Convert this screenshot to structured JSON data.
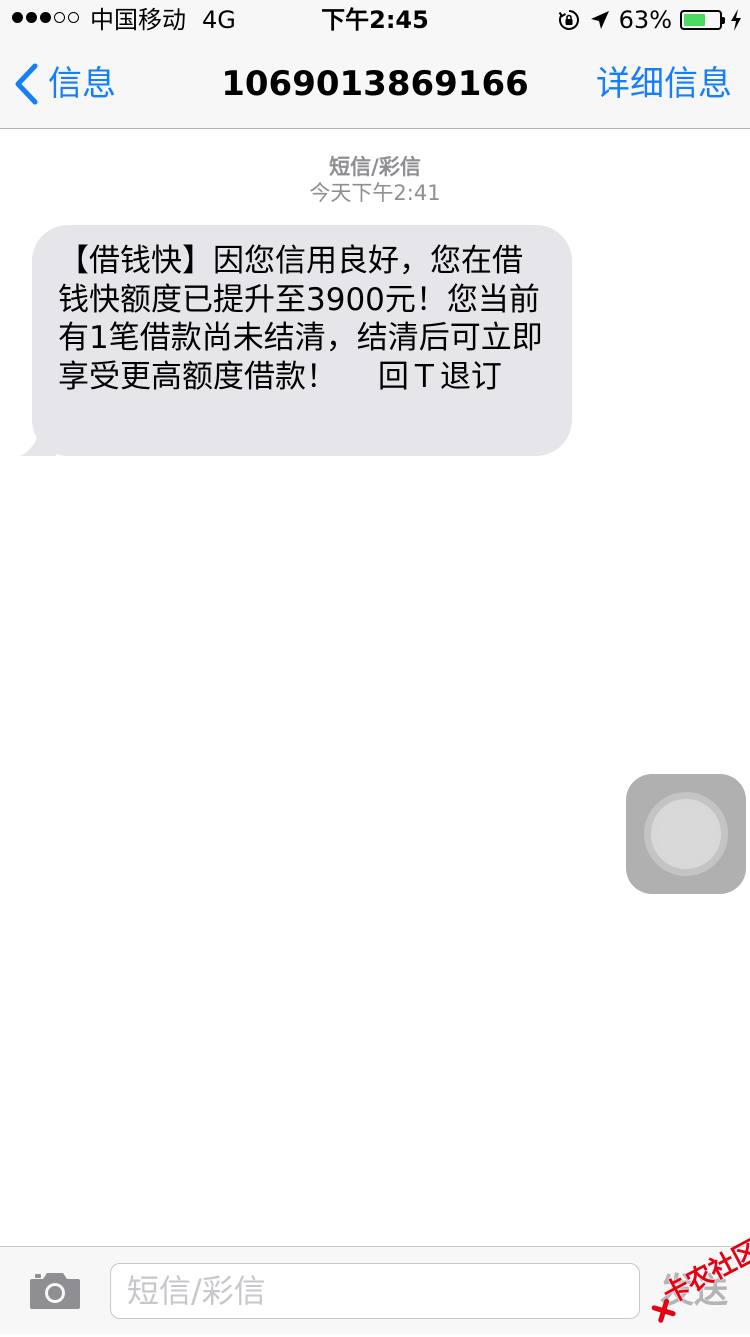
{
  "status_bar": {
    "carrier": "中国移动",
    "network": "4G",
    "time": "下午2:45",
    "battery_percent": "63%",
    "battery_level": 0.63,
    "signal_bars_filled": 3,
    "signal_bars_total": 5,
    "icons": [
      "rotation-lock-icon",
      "location-arrow-icon",
      "battery-icon",
      "charging-bolt-icon"
    ]
  },
  "nav": {
    "back_label": "信息",
    "title": "1069013869166",
    "details_label": "详细信息"
  },
  "conversation": {
    "message_type": "短信/彩信",
    "timestamp": "今天下午2:41",
    "messages": [
      {
        "direction": "incoming",
        "text": "【借钱快】因您信用良好，您在借钱快额度已提升至3900元！您当前有1笔借款尚未结清，结清后可立即享受更高额度借款！　 回Ｔ退订"
      }
    ]
  },
  "input_bar": {
    "placeholder": "短信/彩信",
    "value": "",
    "send_label": "发送"
  },
  "watermark": {
    "text": "卡农社区"
  },
  "colors": {
    "accent": "#157efb",
    "incoming_bubble": "#e5e5ea",
    "bar_background": "#f7f7f7",
    "battery_fill": "#4cd964",
    "secondary_text": "#8e8e93",
    "watermark": "#e60012"
  }
}
